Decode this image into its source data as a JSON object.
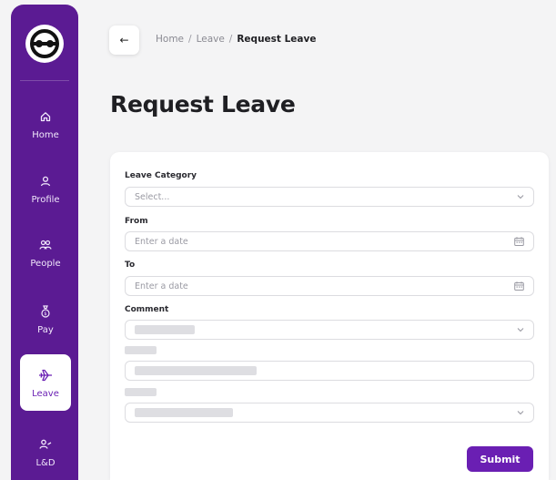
{
  "sidebar": {
    "logo_icon": "company-logo-icon",
    "items": [
      {
        "label": "Home",
        "icon": "home-icon"
      },
      {
        "label": "Profile",
        "icon": "user-icon"
      },
      {
        "label": "People",
        "icon": "people-icon"
      },
      {
        "label": "Pay",
        "icon": "money-bag-icon"
      },
      {
        "label": "Leave",
        "icon": "airplane-icon",
        "active": true
      },
      {
        "label": "L&D",
        "icon": "learning-icon"
      }
    ]
  },
  "header": {
    "back_icon": "arrow-left-icon",
    "breadcrumb": [
      "Home",
      "Leave",
      "Request Leave"
    ],
    "separator": "/",
    "title": "Request Leave"
  },
  "form": {
    "leave_category": {
      "label": "Leave Category",
      "placeholder": "Select..."
    },
    "from": {
      "label": "From",
      "placeholder": "Enter a date"
    },
    "to": {
      "label": "To",
      "placeholder": "Enter a date"
    },
    "comment": {
      "label": "Comment"
    },
    "submit_label": "Submit"
  },
  "colors": {
    "brand": "#5b1b93",
    "accent": "#6a1fb3",
    "background": "#f4f4f5"
  }
}
